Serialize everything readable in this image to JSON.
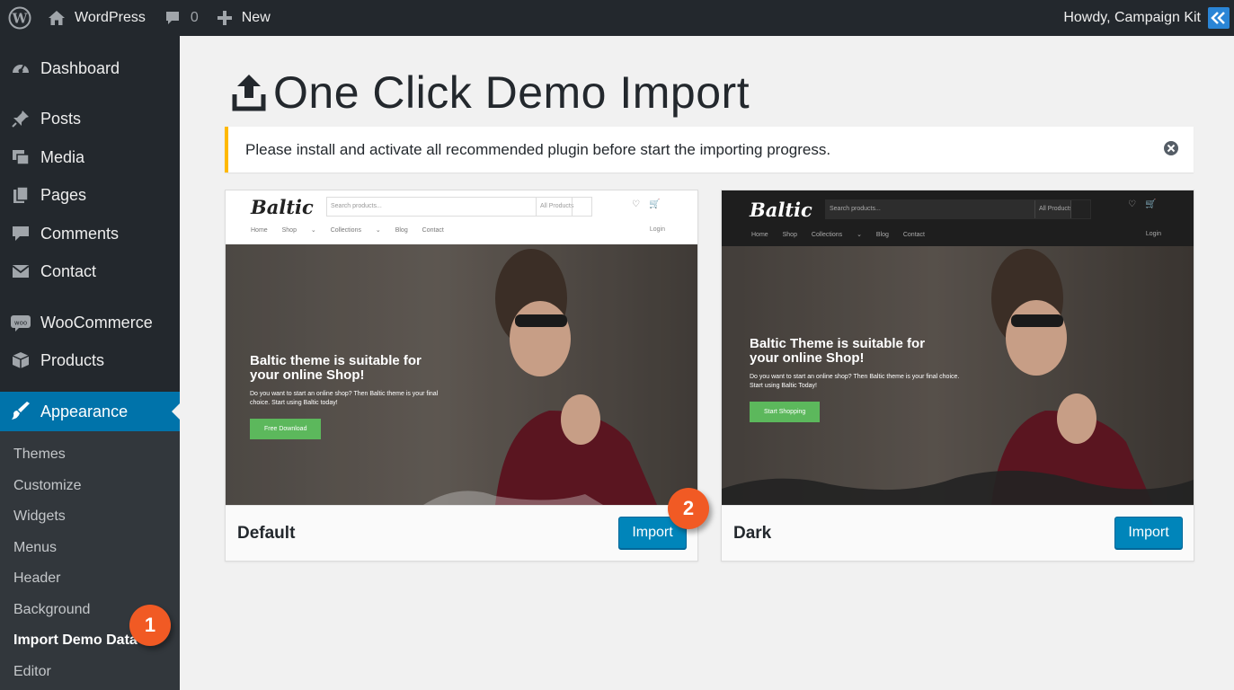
{
  "adminbar": {
    "site_name": "WordPress",
    "comments_count": "0",
    "new_label": "New",
    "howdy": "Howdy, Campaign Kit"
  },
  "sidebar": {
    "items": [
      {
        "label": "Dashboard",
        "icon": "dashboard-icon"
      },
      {
        "label": "Posts",
        "icon": "pin-icon"
      },
      {
        "label": "Media",
        "icon": "media-icon"
      },
      {
        "label": "Pages",
        "icon": "pages-icon"
      },
      {
        "label": "Comments",
        "icon": "comment-icon"
      },
      {
        "label": "Contact",
        "icon": "mail-icon"
      },
      {
        "label": "WooCommerce",
        "icon": "woo-icon"
      },
      {
        "label": "Products",
        "icon": "box-icon"
      },
      {
        "label": "Appearance",
        "icon": "paintbrush-icon"
      }
    ],
    "submenu": [
      "Themes",
      "Customize",
      "Widgets",
      "Menus",
      "Header",
      "Background",
      "Import Demo Data",
      "Editor"
    ],
    "active_submenu": "Import Demo Data"
  },
  "badges": {
    "step1": "1",
    "step2": "2"
  },
  "page": {
    "title": "One Click Demo Import",
    "notice": "Please install and activate all recommended plugin before start the importing progress."
  },
  "demos": [
    {
      "name": "Default",
      "button": "Import",
      "preview": {
        "logo": "Baltic",
        "search_placeholder": "Search products...",
        "category": "All Products",
        "nav": "Home Shop ⌄ Collections ⌄ Blog Contact",
        "login": "Login",
        "heading": "Baltic theme is suitable for your online Shop!",
        "text": "Do you want to start an online shop? Then Baltic theme is your final choice. Start using Baltic today!",
        "cta": "Free Download"
      }
    },
    {
      "name": "Dark",
      "button": "Import",
      "preview": {
        "logo": "Baltic",
        "search_placeholder": "Search products...",
        "category": "All Products",
        "nav": "Home Shop Collections ⌄ Blog Contact",
        "login": "Login",
        "heading": "Baltic Theme is suitable for your online Shop!",
        "text": "Do you want to start an online shop? Then Baltic theme is your final choice. Start using Baltic Today!",
        "cta": "Start Shopping"
      }
    }
  ],
  "colors": {
    "admin_dark": "#23282d",
    "submenu_bg": "#32373c",
    "accent_blue": "#0073aa",
    "button_blue": "#0085ba",
    "notice_warning": "#ffb900",
    "badge_orange": "#f15a24",
    "cta_green": "#5cb85c"
  }
}
